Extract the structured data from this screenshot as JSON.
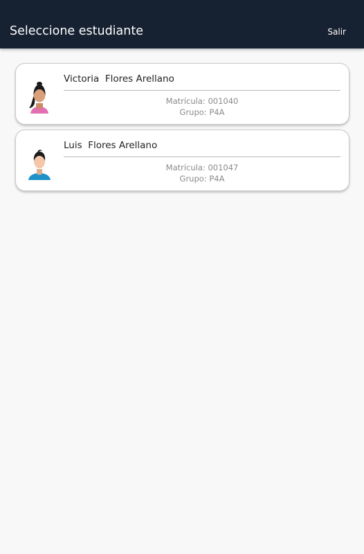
{
  "header": {
    "title": "Seleccione estudiante",
    "logout_label": "Salir",
    "background_color": "#162131"
  },
  "students": [
    {
      "name": "Victoria  Flores Arellano",
      "matricula": "Matrícula: 001040",
      "grupo": "Grupo: P4A",
      "avatar_icon": "female-student-avatar-icon"
    },
    {
      "name": "Luis  Flores Arellano",
      "matricula": "Matrícula: 001047",
      "grupo": "Grupo: P4A",
      "avatar_icon": "male-student-avatar-icon"
    }
  ]
}
